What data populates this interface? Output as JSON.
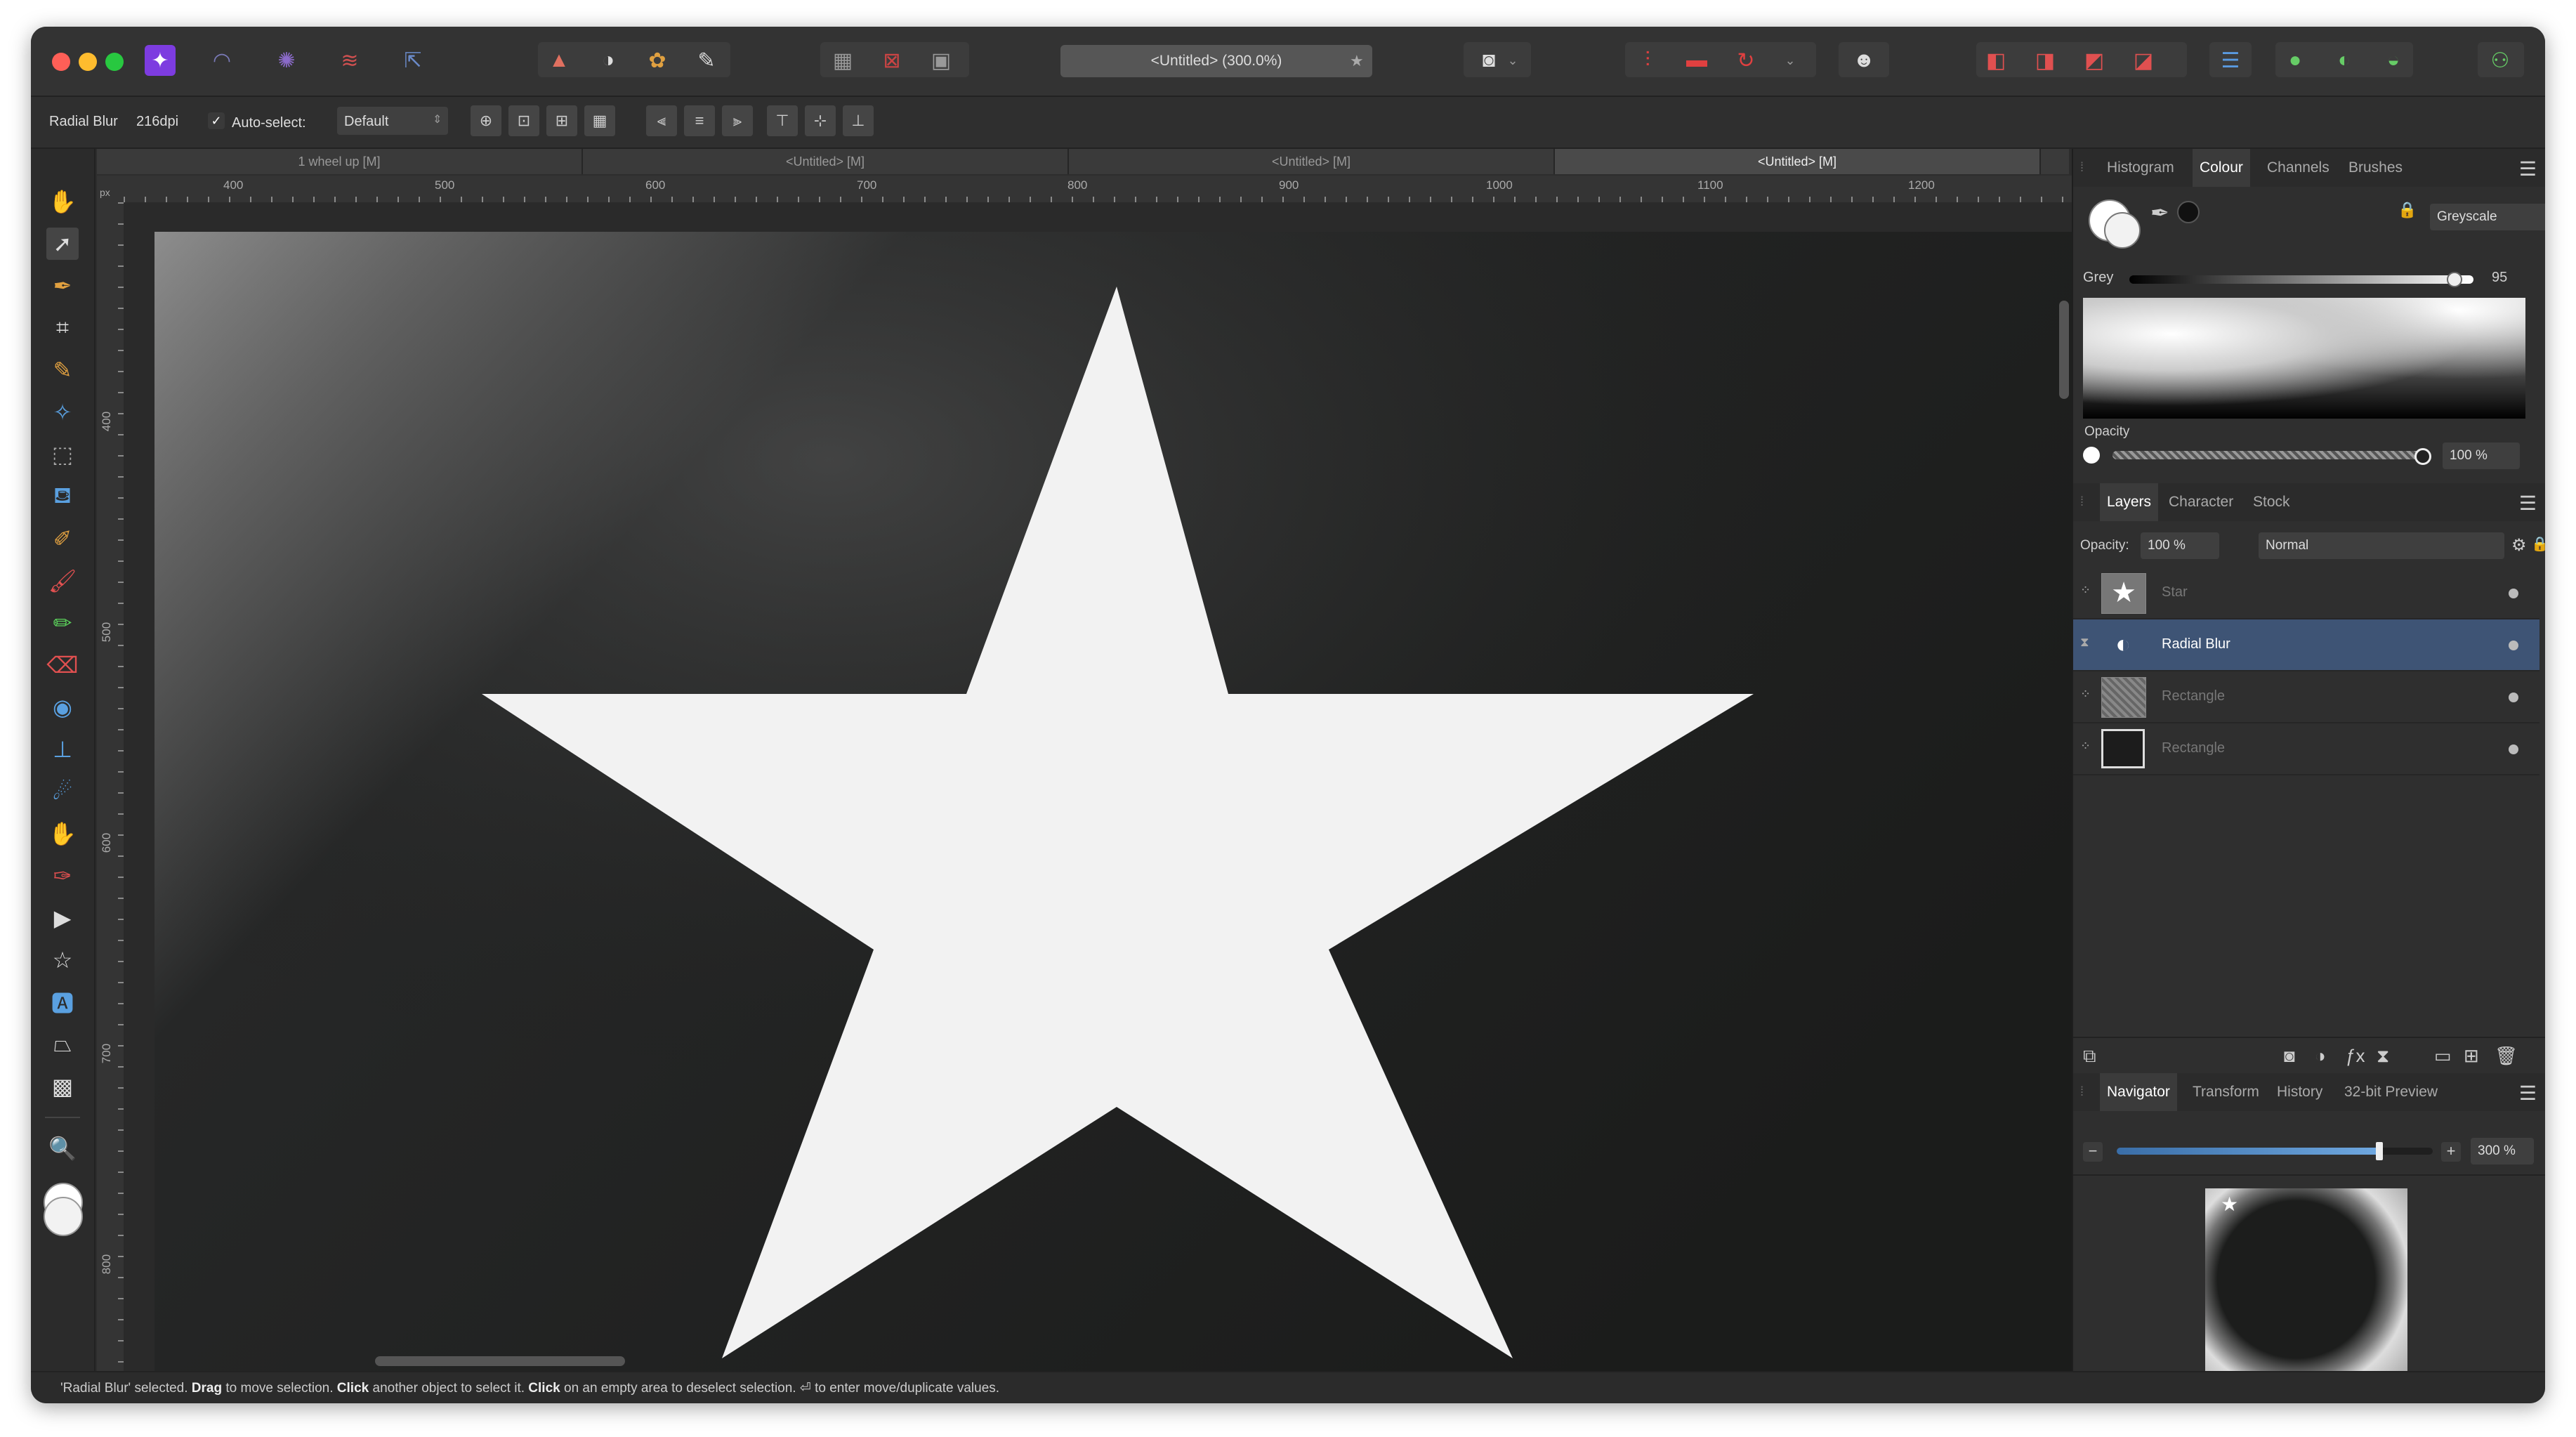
{
  "window": {
    "title": "<Untitled> (300.0%)",
    "title_star": "★"
  },
  "context_bar": {
    "tool_name": "Radial Blur",
    "dpi": "216dpi",
    "auto_select_label": "Auto-select:",
    "auto_select_value": "Default"
  },
  "doc_tabs": [
    "1 wheel up [M]",
    "<Untitled> [M]",
    "<Untitled> [M]",
    "<Untitled> [M]"
  ],
  "ruler": {
    "unit": "px",
    "h_ticks": [
      "400",
      "500",
      "600",
      "700",
      "800",
      "900",
      "1000",
      "1100",
      "1200"
    ],
    "v_ticks": [
      "400",
      "500",
      "600",
      "700",
      "800"
    ]
  },
  "colour_panel": {
    "tabs": [
      "Histogram",
      "Colour",
      "Channels",
      "Brushes"
    ],
    "active_tab": "Colour",
    "mode": "Greyscale",
    "grey_label": "Grey",
    "grey_value": "95",
    "opacity_label": "Opacity",
    "opacity_value": "100 %"
  },
  "layers_panel": {
    "tabs": [
      "Layers",
      "Character",
      "Stock"
    ],
    "active_tab": "Layers",
    "opacity_label": "Opacity:",
    "opacity_value": "100 %",
    "blend_mode": "Normal",
    "layers": [
      {
        "name": "Star",
        "selected": false
      },
      {
        "name": "Radial Blur",
        "selected": true
      },
      {
        "name": "Rectangle",
        "selected": false
      },
      {
        "name": "Rectangle",
        "selected": false
      }
    ]
  },
  "navigator_panel": {
    "tabs": [
      "Navigator",
      "Transform",
      "History",
      "32-bit Preview"
    ],
    "active_tab": "Navigator",
    "zoom_value": "300 %",
    "zoom_level": 0.83
  },
  "status": {
    "part1": "'Radial Blur' selected. ",
    "b1": "Drag",
    "part2": " to move selection. ",
    "b2": "Click",
    "part3": " another object to select it. ",
    "b3": "Click",
    "part4": " on an empty area to deselect selection. ⏎ to enter move/duplicate values."
  },
  "colors": {
    "accent": "#3e5475",
    "canvas_bg": "#1c1d1c",
    "star_fill": "#f2f2f2"
  }
}
